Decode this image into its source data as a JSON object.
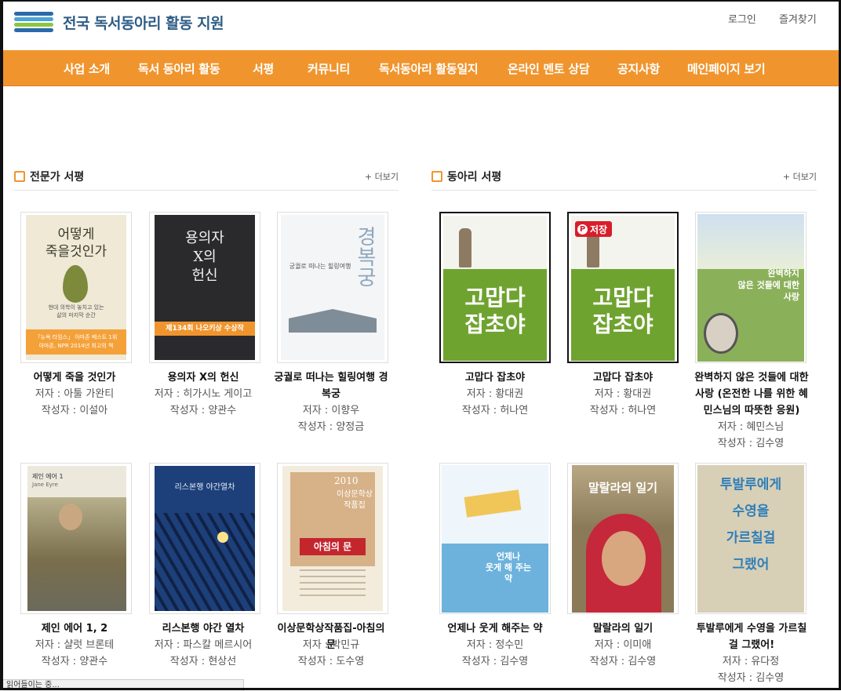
{
  "header": {
    "site_title": "전국 독서동아리 활동 지원",
    "login": "로그인",
    "favorites": "즐겨찾기"
  },
  "nav": [
    "사업 소개",
    "독서 동아리 활동",
    "서평",
    "커뮤니티",
    "독서동아리 활동일지",
    "온라인 멘토 상담",
    "공지사항",
    "메인페이지 보기"
  ],
  "expert": {
    "title": "전문가 서평",
    "more": "+ 더보기",
    "books": [
      {
        "title": "어떻게 죽을 것인가",
        "author": "저자 : 아툴 가완티",
        "writer": "작성자 : 이설아",
        "cover_title": "어떻게\n죽을것인가",
        "cover_sub": "현대 의학이 놓치고 있는\n삶의 마지막 순간",
        "cover_band": "「뉴욕 타임스」 아마존 베스트 1위\n아마존, NPR 2014년 최고의 책"
      },
      {
        "title": "용의자 X의 헌신",
        "author": "저자 : 히가시노 게이고",
        "writer": "작성자 : 양관수",
        "cover_title": "용의자\nX의\n헌신",
        "cover_band": "제134회 나오키상 수상작"
      },
      {
        "title": "궁궐로 떠나는 힐링여행 경복궁",
        "author": "저자 : 이향우",
        "writer": "작성자 : 양정금",
        "cover_title": "경복궁",
        "cover_sub": "궁궐로 떠나는 힐링여행"
      },
      {
        "title": "제인 에어 1, 2",
        "author": "저자 : 샬럿 브론테",
        "writer": "작성자 : 양관수",
        "cover_title": "제인 에어 1",
        "cover_sub": "Jane Eyre"
      },
      {
        "title": "리스본행 야간 열차",
        "author": "저자 : 파스칼 메르시어",
        "writer": "작성자 : 현상선",
        "cover_title": "리스본행 야간열차"
      },
      {
        "title": "이상문학상작품집-아침의 문",
        "author": "저자 : 박민규",
        "writer": "작성자 : 도수영",
        "cover_title": "이상문학상\n작품집",
        "cover_year": "2010",
        "cover_band": "아침의 문"
      }
    ]
  },
  "club": {
    "title": "동아리 서평",
    "more": "+ 더보기",
    "save_label": "저장",
    "books": [
      {
        "title": "고맙다 잡초야",
        "author": "저자 : 황대권",
        "writer": "작성자 : 허나연",
        "cover_title": "고맙다\n잡초야"
      },
      {
        "title": "고맙다 잡초야",
        "author": "저자 : 황대권",
        "writer": "작성자 : 허나연",
        "cover_title": "고맙다\n잡초야"
      },
      {
        "title": "완벽하지 않은 것들에 대한 사랑 (온전한 나를 위한 혜민스님의 따뜻한 응원)",
        "author": "저자 : 혜민스님",
        "writer": "작성자 : 김수영",
        "cover_title": "완벽하지\n않은 것들에 대한\n사랑"
      },
      {
        "title": "언제나 웃게 해주는 약",
        "author": "저자 : 정수민",
        "writer": "작성자 : 김수영",
        "cover_title": "언제나\n웃게 해 주는\n약"
      },
      {
        "title": "말랄라의 일기",
        "author": "저자 : 이미애",
        "writer": "작성자 : 김수영",
        "cover_title": "말랄라의 일기"
      },
      {
        "title": "투발루에게 수영을 가르칠 걸 그랬어!",
        "author": "저자 : 유다정",
        "writer": "작성자 : 김수영",
        "cover_title": "투발루에게\n수영을\n가르칠걸\n그랬어"
      }
    ]
  },
  "status_text": "읽어들이는 중..."
}
